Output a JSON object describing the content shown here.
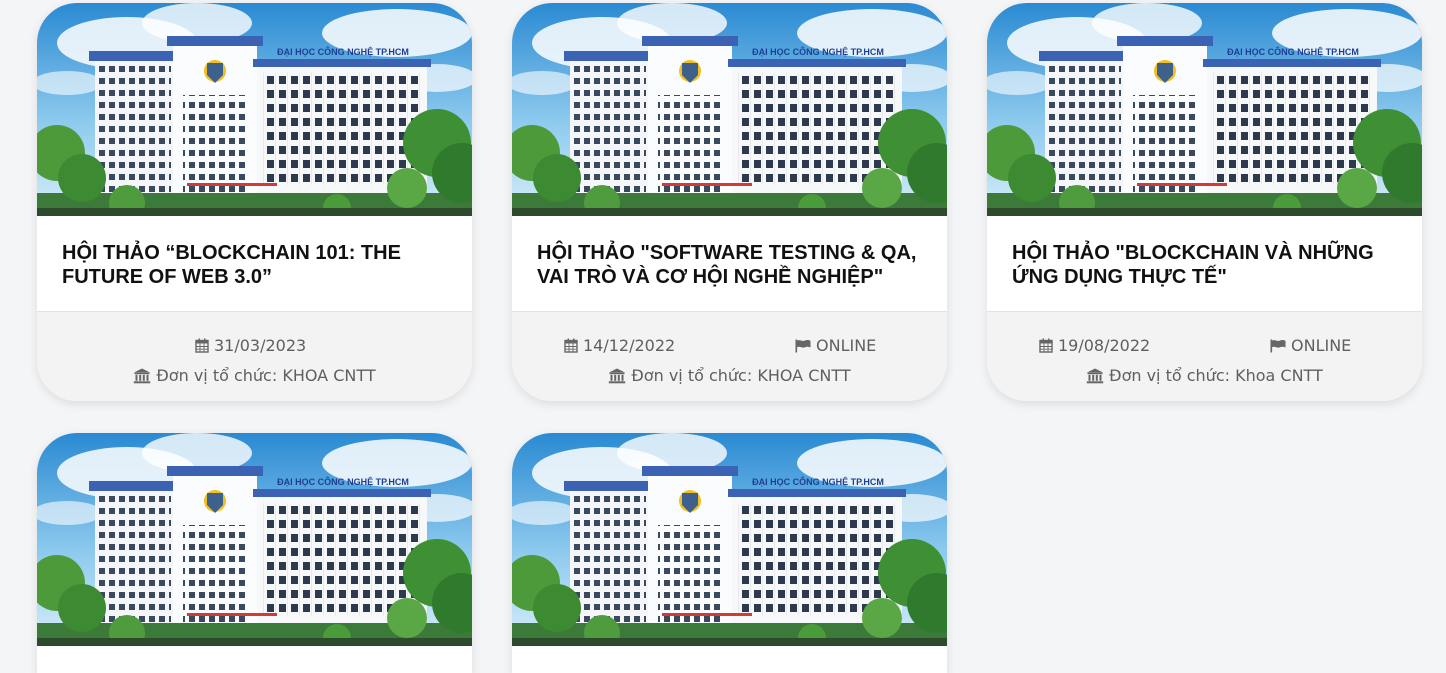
{
  "image": {
    "banner_text": "ĐẠI HỌC CÔNG NGHỆ TP.HCM",
    "colors": {
      "sky_top": "#2b8fd6",
      "sky_bottom": "#bfe3f7",
      "roof_blue": "#3c62b3",
      "greenery": "#2e7a2e"
    }
  },
  "icons": {
    "date": "calendar-icon",
    "format": "flag-icon",
    "organizer": "institution-icon"
  },
  "events": [
    {
      "title": "HỘI THẢO “BLOCKCHAIN 101: THE FUTURE OF WEB 3.0”",
      "date": "31/03/2023",
      "format": "",
      "organizer": "Đơn vị tổ chức: KHOA CNTT"
    },
    {
      "title": "HỘI THẢO \"SOFTWARE TESTING & QA, VAI TRÒ VÀ CƠ HỘI NGHỀ NGHIỆP\"",
      "date": "14/12/2022",
      "format": "ONLINE",
      "organizer": "Đơn vị tổ chức: KHOA CNTT"
    },
    {
      "title": "HỘI THẢO \"BLOCKCHAIN VÀ NHỮNG ỨNG DỤNG THỰC TẾ\"",
      "date": "19/08/2022",
      "format": "ONLINE",
      "organizer": "Đơn vị tổ chức: Khoa CNTT"
    },
    {
      "title": "",
      "date": "",
      "format": "",
      "organizer": ""
    },
    {
      "title": "",
      "date": "",
      "format": "",
      "organizer": ""
    }
  ]
}
